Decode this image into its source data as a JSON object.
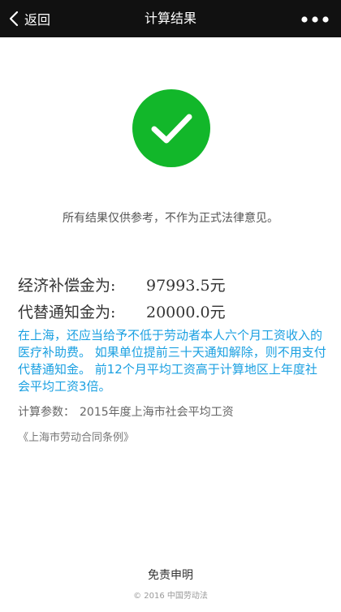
{
  "nav": {
    "back_label": "返回",
    "title": "计算结果",
    "more_icon": "more-icon"
  },
  "status": {
    "icon": "checkmark-icon",
    "color": "#12b72a"
  },
  "disclaimer": "所有结果仅供参考，不作为正式法律意见。",
  "results": [
    {
      "label": "经济补偿金为:",
      "value": "97993.5元"
    },
    {
      "label": "代替通知金为:",
      "value": "20000.0元"
    }
  ],
  "note": "在上海，还应当给予不低于劳动者本人六个月工资收入的医疗补助费。 如果单位提前三十天通知解除，则不用支付代替通知金。 前12个月平均工资高于计算地区上年度社会平均工资3倍。",
  "note_color": "#1ba0e1",
  "params": {
    "label": "计算参数：",
    "value": "2015年度上海市社会平均工资"
  },
  "regulation": "《上海市劳动合同条例》",
  "footer": {
    "link_label": "免责申明",
    "copyright": "© 2016 中国劳动法"
  }
}
